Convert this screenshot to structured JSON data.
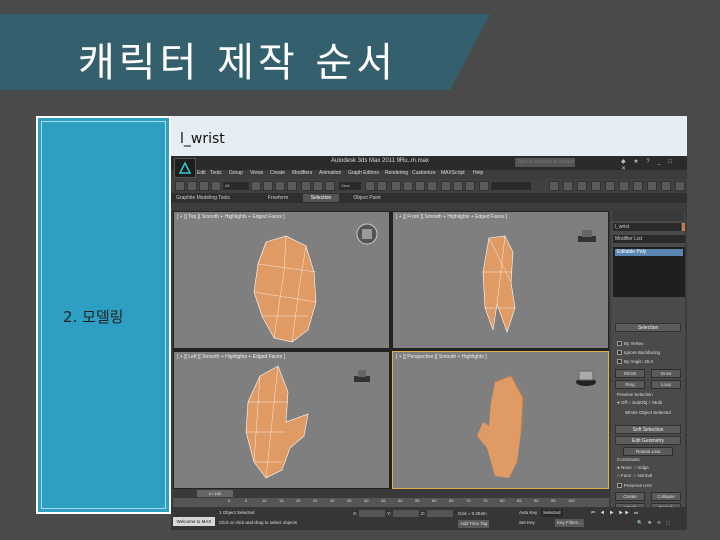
{
  "slide": {
    "title": "캐릭터 제작 순서",
    "step_label": "2. 모델링",
    "caption": "l_wrist"
  },
  "app": {
    "window_title": "Autodesk 3ds Max  2011    9Ru..m.max",
    "search_placeholder": "Type a keyword or phrase",
    "menu": [
      "Edit",
      "Tools",
      "Group",
      "Views",
      "Create",
      "Modifiers",
      "Animation",
      "Graph Editors",
      "Rendering",
      "Customize",
      "MAXScript",
      "Help"
    ],
    "toolbar": {
      "filter": "All",
      "ref_coord": "View"
    },
    "ribbon_tabs": [
      "Graphite Modeling Tools",
      "Freeform",
      "Selection",
      "Object Paint"
    ],
    "ribbon_active": "Selection",
    "viewports": [
      {
        "label": "[ + ][ Top ][ Smooth + Highlights + Edged Faces ]"
      },
      {
        "label": "[ + ][ Front ][ Smooth + Highlights + Edged Faces ]"
      },
      {
        "label": "[ + ][ Left ][ Smooth + Highlights + Edged Faces ]"
      },
      {
        "label": "[ + ][ Perspective ][ Smooth + Highlights ]"
      }
    ],
    "command_panel": {
      "object_name": "l_wrist",
      "modifier_list": "Modifier List",
      "stack_item": "Editable Poly",
      "selection_title": "Selection",
      "options": [
        "By Vertex",
        "Ignore Backfacing",
        "By Angle:"
      ],
      "by_angle_value": "45.0",
      "shrink": "Shrink",
      "grow": "Grow",
      "ring": "Ring",
      "loop": "Loop",
      "preview_selection": "Preview Selection",
      "preview_options": [
        "Off",
        "SubObj",
        "Multi"
      ],
      "whole_object": "Whole Object Selected",
      "soft_selection": "Soft Selection",
      "edit_geometry": "Edit Geometry",
      "repeat_last": "Repeat Last",
      "constraints": "Constraints",
      "constraint_options": [
        "None",
        "Edge",
        "Face",
        "Normal"
      ],
      "preserve_uvs": "Preserve UVs",
      "create": "Create",
      "collapse": "Collapse",
      "attach": "Attach",
      "detach": "Detach"
    },
    "timeline": {
      "slider": "0 / 100",
      "ticks": [
        "0",
        "5",
        "10",
        "15",
        "20",
        "25",
        "30",
        "35",
        "40",
        "45",
        "50",
        "55",
        "60",
        "65",
        "70",
        "75",
        "80",
        "85",
        "90",
        "95",
        "100"
      ]
    },
    "status": {
      "welcome": "Welcome to MAX",
      "selected": "1 Object Selected",
      "prompt": "Click or click-and-drag to select objects",
      "x_label": "X:",
      "y_label": "Y:",
      "z_label": "Z:",
      "grid": "Grid = 0.254m",
      "add_time_tag": "Add Time Tag",
      "auto_key": "Auto Key",
      "selected_dropdown": "Selected",
      "set_key": "Set Key",
      "key_filters": "Key Filters..."
    }
  },
  "colors": {
    "background": "#4a4a4a",
    "title_band": "#34606e",
    "left_panel": "#2d9fc2",
    "model_skin": "#e09a64",
    "active_viewport": "#d9b24a"
  }
}
